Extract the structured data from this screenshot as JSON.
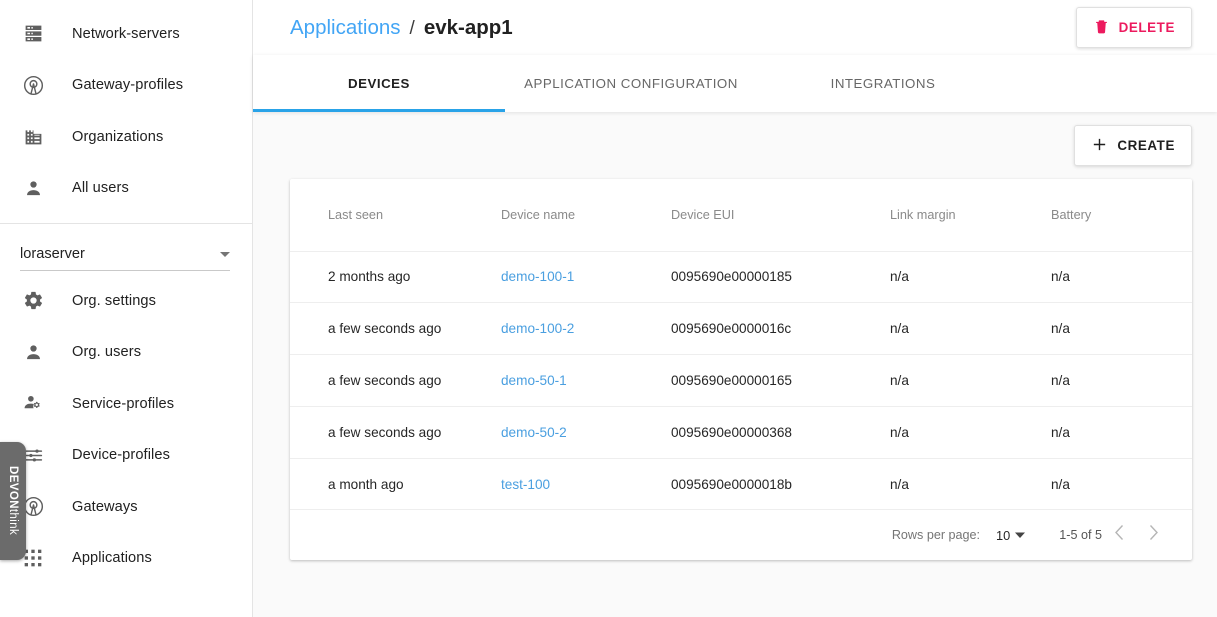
{
  "sidebar": {
    "top_items": [
      {
        "label": "Network-servers",
        "icon": "server-stack-icon"
      },
      {
        "label": "Gateway-profiles",
        "icon": "antenna-icon"
      },
      {
        "label": "Organizations",
        "icon": "building-icon"
      },
      {
        "label": "All users",
        "icon": "person-icon"
      }
    ],
    "organization": {
      "name": "loraserver",
      "caret": "chevron-down-icon"
    },
    "bottom_items": [
      {
        "label": "Org. settings",
        "icon": "gear-icon"
      },
      {
        "label": "Org. users",
        "icon": "person-icon"
      },
      {
        "label": "Service-profiles",
        "icon": "person-gear-icon"
      },
      {
        "label": "Device-profiles",
        "icon": "tune-sliders-icon"
      },
      {
        "label": "Gateways",
        "icon": "antenna-icon"
      },
      {
        "label": "Applications",
        "icon": "apps-grid-icon"
      }
    ],
    "side_tab": {
      "bold": "DEVON",
      "thin": "think"
    }
  },
  "header": {
    "breadcrumb_root": "Applications",
    "breadcrumb_separator": "/",
    "breadcrumb_current": "evk-app1",
    "delete_label": "DELETE",
    "delete_icon": "trash-icon",
    "delete_color": "#ec1a5e"
  },
  "tabs": [
    {
      "label": "DEVICES",
      "active": true
    },
    {
      "label": "APPLICATION CONFIGURATION",
      "active": false
    },
    {
      "label": "INTEGRATIONS",
      "active": false
    }
  ],
  "actions": {
    "create_label": "CREATE",
    "create_icon": "plus-icon"
  },
  "table": {
    "columns": [
      "Last seen",
      "Device name",
      "Device EUI",
      "Link margin",
      "Battery"
    ],
    "rows": [
      {
        "last_seen": "2 months ago",
        "device_name": "demo-100-1",
        "device_eui": "0095690e00000185",
        "link_margin": "n/a",
        "battery": "n/a"
      },
      {
        "last_seen": "a few seconds ago",
        "device_name": "demo-100-2",
        "device_eui": "0095690e0000016c",
        "link_margin": "n/a",
        "battery": "n/a"
      },
      {
        "last_seen": "a few seconds ago",
        "device_name": "demo-50-1",
        "device_eui": "0095690e00000165",
        "link_margin": "n/a",
        "battery": "n/a"
      },
      {
        "last_seen": "a few seconds ago",
        "device_name": "demo-50-2",
        "device_eui": "0095690e00000368",
        "link_margin": "n/a",
        "battery": "n/a"
      },
      {
        "last_seen": "a month ago",
        "device_name": "test-100",
        "device_eui": "0095690e0000018b",
        "link_margin": "n/a",
        "battery": "n/a"
      }
    ]
  },
  "pagination": {
    "rows_per_page_label": "Rows per page:",
    "rows_per_page_value": "10",
    "range_label": "1-5 of 5",
    "prev_icon": "chevron-left-icon",
    "next_icon": "chevron-right-icon"
  },
  "colors": {
    "link_blue": "#4a9fe0",
    "breadcrumb_blue": "#42a5f5",
    "tab_indicator": "#29a3e8",
    "delete_pink": "#ec1a5e"
  }
}
